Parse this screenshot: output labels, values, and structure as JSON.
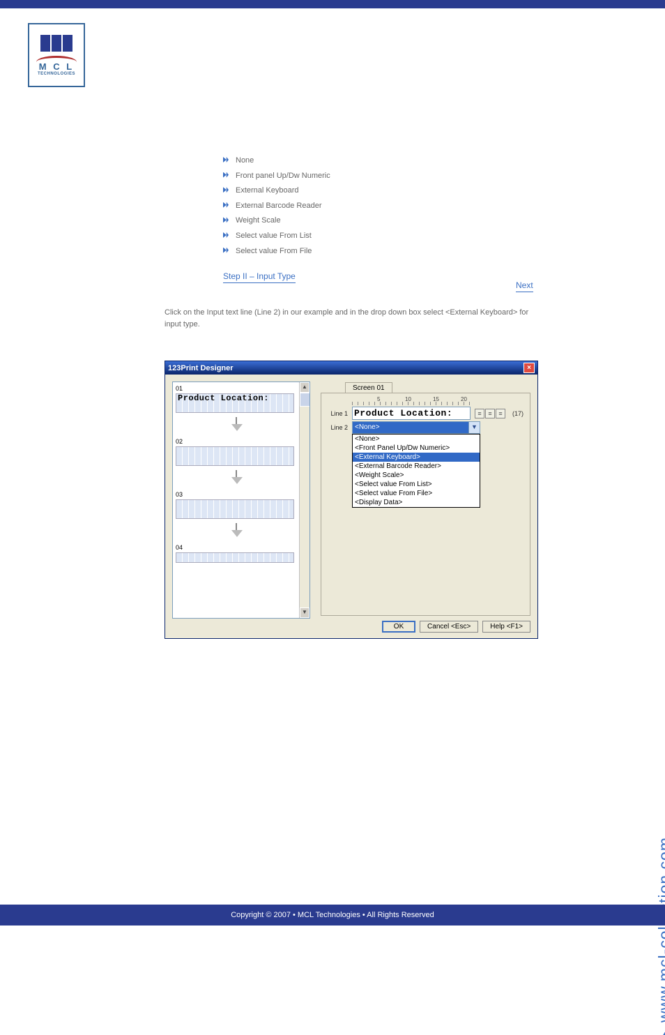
{
  "list_items": [
    "None",
    "Front panel Up/Dw Numeric",
    "External Keyboard",
    "External Barcode Reader",
    "Weight Scale",
    "Select value From List",
    "Select value From File"
  ],
  "step_link": "Step II – Input Type",
  "next_link": "Next",
  "intro": "Click on the Input text line (Line 2) in our example and in the drop down box select <External Keyboard> for input type.",
  "window": {
    "title": "123Print Designer",
    "tab": "Screen 01",
    "line1_label": "Line 1",
    "line1_text": "Product Location:",
    "line2_label": "Line 2",
    "count_text": "(17)",
    "segments": [
      "01",
      "02",
      "03",
      "04"
    ],
    "seg_text_0": "Product Location:",
    "ruler_ticks": [
      "5",
      "10",
      "15",
      "20"
    ],
    "combo_selected": "<None>",
    "combo_options": [
      "<None>",
      "<Front Panel Up/Dw Numeric>",
      "<External Keyboard>",
      "<External Barcode Reader>",
      "<Weight Scale>",
      "<Select value From List>",
      "<Select value From File>",
      "<Display Data>"
    ],
    "buttons": {
      "ok": "OK",
      "cancel": "Cancel <Esc>",
      "help": "Help <F1>"
    }
  },
  "side_url": "www.mcl-collection.com",
  "footer": "Copyright © 2007 • MCL Technologies • All Rights Reserved",
  "logo_text": "M C L",
  "logo_sub": "TECHNOLOGIES"
}
